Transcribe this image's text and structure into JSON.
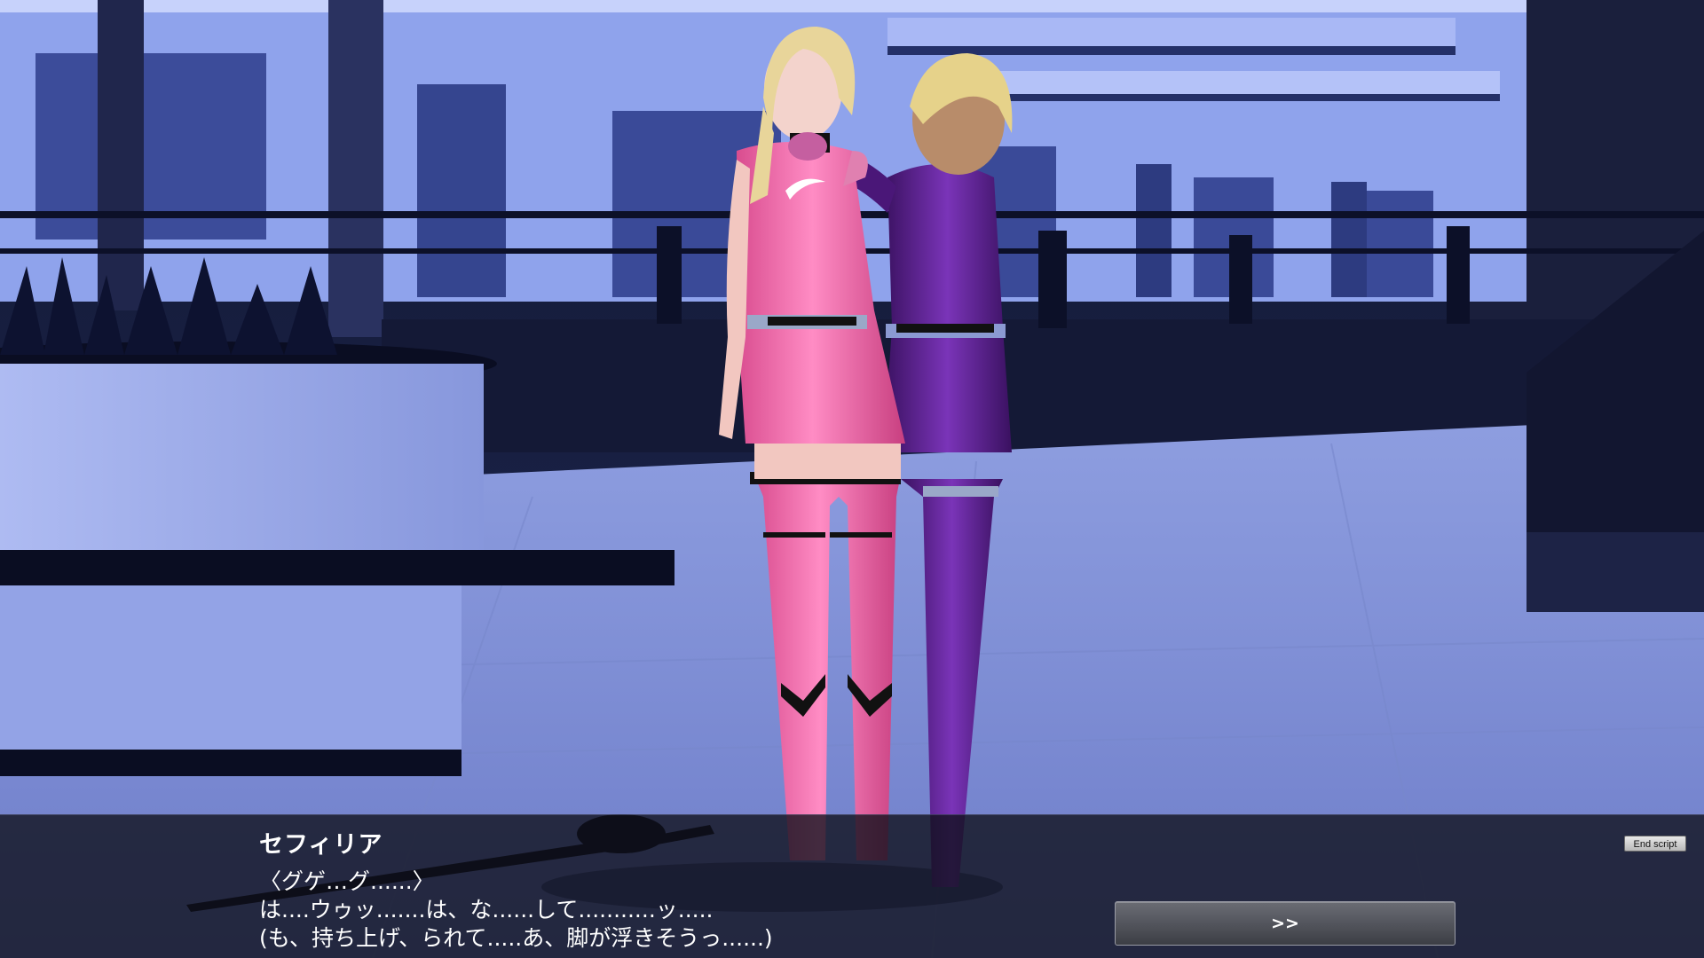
{
  "dialogue": {
    "speaker": "セフィリア",
    "lines": [
      "〈グゲ…グ......〉",
      "は....ウゥッ.......は、な......して...........ッ.....",
      "(も、持ち上げ、られて.....あ、脚が浮きそうっ......)"
    ]
  },
  "controls": {
    "end_script_label": "End script",
    "next_label": ">>"
  },
  "colors": {
    "pink_suit": "#f06aa8",
    "purple_suit": "#5b1f8f",
    "night_sky": "#0b0e1e",
    "building": "#8aa0e8"
  }
}
